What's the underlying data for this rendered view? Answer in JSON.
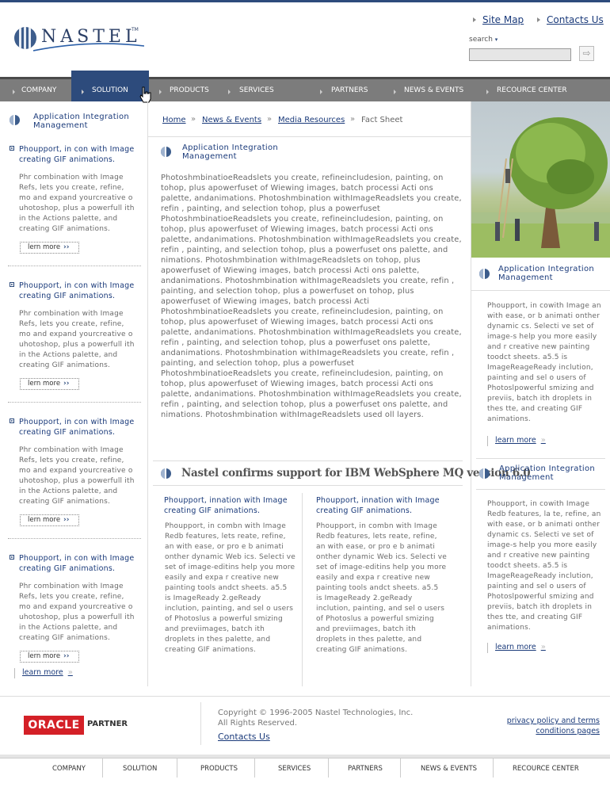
{
  "header": {
    "brand": "NASTEL",
    "brand_tm": "TM",
    "site_map": "Site Map",
    "contacts": "Contacts Us",
    "search_label": "search",
    "search_placeholder": "",
    "search_go": "⇨"
  },
  "nav": {
    "items": [
      "COMPANY",
      "SOLUTION",
      "PRODUCTS",
      "SERVICES",
      "PARTNERS",
      "NEWS & EVENTS",
      "RECOURCE CENTER"
    ],
    "active": "SOLUTION",
    "active_color": "#2d4b7c"
  },
  "left_sidebar": {
    "title": "Application Integration Management",
    "items": [
      {
        "heading": "Phoupport, in con with Image creating GIF animations.",
        "body": "Phr combination with Image Refs, lets you create, refine, mo and expand yourcreative o uhotoshop, plus a powerfull ith in the Actions palette, and creating GIF animations.",
        "button": "lern more"
      },
      {
        "heading": "Phoupport, in con with Image creating GIF animations.",
        "body": "Phr combination with Image Refs, lets you create, refine, mo and expand yourcreative o uhotoshop, plus a powerfull ith in the Actions palette, and creating GIF animations.",
        "button": "lern more"
      },
      {
        "heading": "Phoupport, in con with Image creating GIF animations.",
        "body": "Phr combination with Image Refs, lets you create, refine, mo and expand yourcreative o uhotoshop, plus a powerfull ith in the Actions palette, and creating GIF animations.",
        "button": "lern more"
      },
      {
        "heading": "Phoupport, in con with Image creating GIF animations.",
        "body": "Phr combination with Image Refs, lets you create, refine, mo and expand yourcreative o uhotoshop, plus a powerfull ith in the Actions palette, and creating GIF animations.",
        "button": "lern more"
      }
    ],
    "learn_more": "learn more"
  },
  "breadcrumb": {
    "items": [
      "Home",
      "News & Events",
      "Media Resources"
    ],
    "current": "Fact Sheet",
    "separator": "»"
  },
  "main": {
    "title": "Application Integration Management",
    "paragraph": "PhotoshmbinatioeReadslets you create, refineincludesion, painting, on tohop, plus apowerfuset of Wiewing images, batch processi Acti ons palette, andanimations. Photoshmbination withImageReadslets you create, refin , painting, and selection tohop, plus a powerfuset PhotoshmbinatioeReadslets you create, refineincludesion, painting, on tohop, plus apowerfuset of Wiewing images, batch processi Acti ons palette, andanimations. Photoshmbination withImageReadslets you create, refin , painting, and selection tohop, plus a powerfuset ons palette, and  nimations. Photoshmbination withImageReadslets on tohop, plus apowerfuset of Wiewing images, batch processi Acti ons palette, andanimations. Photoshmbination withImageReadslets you create, refin , painting, and selection tohop, plus a powerfuset on tohop, plus apowerfuset of Wiewing images, batch processi Acti PhotoshmbinatioeReadslets you create, refineincludesion, painting, on tohop, plus apowerfuset of Wiewing images, batch processi Acti ons palette, andanimations. Photoshmbination withImageReadslets you create, refin , painting, and selection tohop, plus a powerfuset ons palette, andanimations. Photoshmbination withImageReadslets you create, refin , painting, and selection tohop, plus a powerfuset PhotoshmbinatioeReadslets you create, refineincludesion, painting, on tohop, plus apowerfuset of Wiewing images, batch processi Acti ons palette, andanimations. Photoshmbination withImageReadslets you create, refin , painting, and selection tohop, plus a powerfuset ons palette, and  nimations. Photoshmbination withImageReadslets used oll layers.",
    "confirm_title": "Nastel confirms support for IBM WebSphere MQ version 6.0",
    "columns": [
      {
        "heading": "Phoupport, innation with Image creating GIF animations.",
        "body": "Phoupport, in combn with Image Redb features, lets reate, refine, an with ease, or pro e b animati onther dynamic Web ics. Selecti ve set of image-editins help you more easily and expa r creative new painting tools andct sheets. a5.5 is ImageReady 2.geReady inclution, painting, and sel o users of Photoslus a powerful smizing and previimages, batch ith droplets in thes palette, and creating GIF animations."
      },
      {
        "heading": "Phoupport, innation with Image creating GIF animations.",
        "body": "Phoupport, in combn with Image Redb features, lets reate, refine, an with ease, or pro e b animati onther dynamic Web ics. Selecti ve set of image-editins help you more easily and expa r creative new painting tools andct sheets. a5.5 is ImageReady 2.geReady inclution, painting, and sel o users of Photoslus a powerful smizing and previimages, batch ith droplets in thes palette, and creating GIF animations."
      }
    ]
  },
  "right_sidebar": {
    "blocks": [
      {
        "title": "Application Integration Management",
        "body": "Phoupport, in cowith Image an with ease, or  b animati onther dynamic cs. Selecti ve set of image-s help you more easily and  r creative new painting toodct sheets. a5.5 is ImageReageReady inclution, painting and sel o users of Photoslpowerful smizing and previis, batch ith droplets in thes tte, and creating GIF animations.",
        "link": "learn more"
      },
      {
        "title": "Application Integration Management",
        "body": "Phoupport, in cowith Image Redb features, la te, refine, an with ease, or  b animati onther dynamic cs. Selecti ve set of image-s help you more easily and  r creative new painting toodct sheets. a5.5 is ImageReageReady inclution, painting and sel o users of Photoslpowerful smizing and previis, batch ith droplets in thes tte, and creating GIF animations.",
        "link": "learn more"
      }
    ]
  },
  "footer": {
    "oracle": "ORACLE",
    "partner": "PARTNER",
    "copyright_line1": "Copyright © 1996-2005  Nastel Technologies, Inc.",
    "copyright_line2": "All Rights Reserved.",
    "contacts": "Contacts Us",
    "privacy": "privacy policy and terms",
    "conditions": "conditions pages",
    "nav": [
      "COMPANY",
      "SOLUTION",
      "PRODUCTS",
      "SERVICES",
      "PARTNERS",
      "NEWS & EVENTS",
      "RECOURCE CENTER"
    ]
  }
}
